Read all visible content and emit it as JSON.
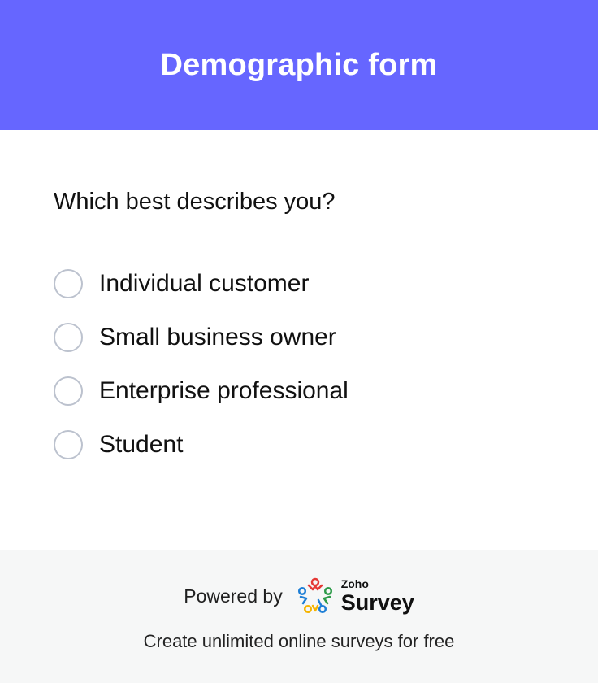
{
  "header": {
    "title": "Demographic form"
  },
  "question": {
    "text": "Which best describes you?",
    "options": [
      "Individual customer",
      "Small business owner",
      "Enterprise professional",
      "Student"
    ]
  },
  "footer": {
    "powered_by": "Powered by",
    "brand_small": "Zoho",
    "brand_name": "Survey",
    "tagline": "Create unlimited online surveys for free"
  },
  "colors": {
    "header_background": "#6666ff",
    "footer_background": "#f6f7f7",
    "radio_border": "#bcc2ce",
    "logo_red": "#e53935",
    "logo_green": "#2e9b4a",
    "logo_blue": "#1e7fd6",
    "logo_yellow": "#f5b400"
  }
}
